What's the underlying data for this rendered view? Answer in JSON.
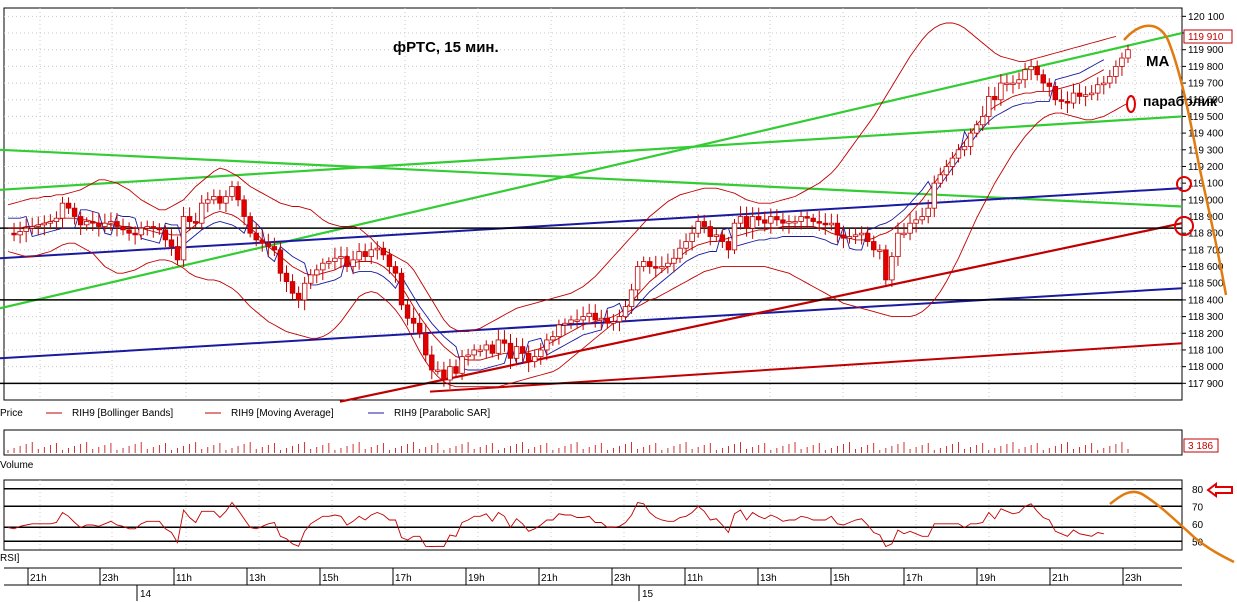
{
  "chart_data": {
    "type": "candlestick",
    "title": "фРТС,  15 мин.",
    "instrument": "RIH9",
    "price_axis": {
      "ylim": [
        117800,
        120150
      ],
      "ticks": [
        "120 100",
        "120 000",
        "119 900",
        "119 800",
        "119 700",
        "119 600",
        "119 500",
        "119 400",
        "119 300",
        "119 200",
        "119 100",
        "119 000",
        "118 900",
        "118 800",
        "118 700",
        "118 600",
        "118 500",
        "118 400",
        "118 300",
        "118 200",
        "118 100",
        "118 000",
        "117 900"
      ],
      "tick_values": [
        120100,
        120000,
        119900,
        119800,
        119700,
        119600,
        119500,
        119400,
        119300,
        119200,
        119100,
        119000,
        118900,
        118800,
        118700,
        118600,
        118500,
        118400,
        118300,
        118200,
        118100,
        118000,
        117900
      ],
      "last_price": "119 910"
    },
    "time_axis": {
      "hour_labels": [
        "21h",
        "23h",
        "11h",
        "13h",
        "15h",
        "17h",
        "19h",
        "21h",
        "23h",
        "11h",
        "13h",
        "15h",
        "17h",
        "19h",
        "21h",
        "23h"
      ],
      "day_labels": [
        "14",
        "15"
      ]
    },
    "legend": [
      {
        "label": "Price",
        "color": "#c00000"
      },
      {
        "label": "RIH9 [Bollinger Bands]",
        "color": "#c00000"
      },
      {
        "label": "RIH9 [Moving Average]",
        "color": "#c00000"
      },
      {
        "label": "RIH9 [Parabolic SAR]",
        "color": "#1a1aa0"
      }
    ],
    "annotations": {
      "ma": "MA",
      "parabolic": "параболик"
    },
    "price_series": [
      118800,
      118790,
      118810,
      118830,
      118840,
      118850,
      118860,
      118870,
      118890,
      118980,
      118950,
      118900,
      118850,
      118870,
      118860,
      118840,
      118860,
      118870,
      118840,
      118820,
      118800,
      118790,
      118830,
      118840,
      118830,
      118820,
      118760,
      118720,
      118640,
      118900,
      118870,
      118860,
      118980,
      119000,
      119020,
      118980,
      119020,
      119080,
      119000,
      118900,
      118800,
      118760,
      118740,
      118720,
      118700,
      118560,
      118510,
      118440,
      118400,
      118500,
      118550,
      118580,
      118620,
      118630,
      118650,
      118660,
      118600,
      118640,
      118690,
      118660,
      118700,
      118710,
      118670,
      118600,
      118560,
      118370,
      118290,
      118260,
      118200,
      118070,
      117980,
      117980,
      117920,
      118000,
      117960,
      118060,
      118070,
      118100,
      118100,
      118130,
      118080,
      118160,
      118140,
      118050,
      118120,
      118080,
      118030,
      118060,
      118100,
      118160,
      118180,
      118250,
      118260,
      118280,
      118280,
      118300,
      118320,
      118280,
      118290,
      118260,
      118270,
      118300,
      118360,
      118460,
      118600,
      118630,
      118600,
      118590,
      118600,
      118620,
      118650,
      118710,
      118750,
      118800,
      118870,
      118840,
      118780,
      118790,
      118750,
      118700,
      118860,
      118900,
      118830,
      118900,
      118880,
      118860,
      118900,
      118880,
      118860,
      118870,
      118870,
      118900,
      118890,
      118870,
      118860,
      118850,
      118860,
      118790,
      118770,
      118780,
      118790,
      118800,
      118750,
      118700,
      118700,
      118520,
      118660,
      118800,
      118800,
      118860,
      118880,
      118900,
      118950,
      119100,
      119150,
      119200,
      119250,
      119300,
      119320,
      119400,
      119450,
      119500,
      119620,
      119600,
      119700,
      119700,
      119700,
      119720,
      119780,
      119800,
      119750,
      119700,
      119680,
      119600,
      119590,
      119580,
      119640,
      119620,
      119630,
      119640,
      119690,
      119700,
      119740,
      119800,
      119850,
      119900
    ],
    "moving_average": [
      118830,
      118830,
      118830,
      118840,
      118840,
      118850,
      118860,
      118870,
      118880,
      118890,
      118890,
      118890,
      118880,
      118880,
      118870,
      118860,
      118860,
      118850,
      118850,
      118840,
      118840,
      118830,
      118830,
      118820,
      118810,
      118800,
      118800,
      118790,
      118790,
      118790,
      118820,
      118850,
      118880,
      118900,
      118920,
      118930,
      118920,
      118910,
      118890,
      118860,
      118830,
      118800,
      118760,
      118720,
      118690,
      118660,
      118630,
      118600,
      118580,
      118560,
      118550,
      118550,
      118560,
      118570,
      118580,
      118600,
      118610,
      118620,
      118630,
      118630,
      118630,
      118620,
      118600,
      118570,
      118530,
      118480,
      118420,
      118360,
      118300,
      118250,
      118200,
      118160,
      118120,
      118090,
      118060,
      118050,
      118040,
      118040,
      118040,
      118050,
      118060,
      118070,
      118080,
      118080,
      118080,
      118080,
      118090,
      118100,
      118110,
      118130,
      118150,
      118170,
      118190,
      118210,
      118230,
      118250,
      118260,
      118270,
      118280,
      118290,
      118300,
      118320,
      118350,
      118390,
      118430,
      118470,
      118510,
      118540,
      118570,
      118600,
      118630,
      118660,
      118690,
      118710,
      118730,
      118740,
      118750,
      118750,
      118760,
      118770,
      118780,
      118790,
      118800,
      118810,
      118820,
      118820,
      118830,
      118830,
      118840,
      118840,
      118840,
      118840,
      118840,
      118840,
      118830,
      118820,
      118800,
      118790,
      118780,
      118770,
      118760,
      118760,
      118760,
      118770,
      118790,
      118800,
      118820,
      118850,
      118880,
      118920,
      118960,
      119000,
      119050,
      119100,
      119150,
      119200,
      119250,
      119300,
      119350,
      119400,
      119450,
      119490,
      119530,
      119560,
      119580,
      119600,
      119620,
      119630,
      119640,
      119640,
      119650,
      119650,
      119650,
      119660,
      119670,
      119680,
      119690,
      119700,
      119720,
      119740,
      119760,
      119780
    ],
    "bollinger_upper": [
      118970,
      118980,
      118990,
      119000,
      119010,
      119010,
      119020,
      119020,
      119030,
      119030,
      119040,
      119050,
      119060,
      119080,
      119100,
      119120,
      119120,
      119110,
      119100,
      119080,
      119060,
      119030,
      119000,
      118980,
      118960,
      118940,
      118940,
      118960,
      118980,
      119000,
      119040,
      119080,
      119110,
      119140,
      119170,
      119190,
      119180,
      119160,
      119140,
      119110,
      119080,
      119060,
      119040,
      119020,
      119000,
      118980,
      118970,
      118960,
      118960,
      118950,
      118940,
      118910,
      118880,
      118860,
      118850,
      118840,
      118840,
      118840,
      118830,
      118800,
      118770,
      118730,
      118700,
      118680,
      118660,
      118640,
      118620,
      118580,
      118520,
      118460,
      118400,
      118340,
      118280,
      118240,
      118220,
      118210,
      118210,
      118220,
      118230,
      118250,
      118270,
      118290,
      118310,
      118330,
      118350,
      118360,
      118370,
      118380,
      118390,
      118400,
      118410,
      118420,
      118430,
      118440,
      118460,
      118480,
      118510,
      118540,
      118580,
      118620,
      118660,
      118700,
      118740,
      118780,
      118820,
      118860,
      118900,
      118930,
      118960,
      118990,
      119010,
      119030,
      119040,
      119050,
      119060,
      119070,
      119070,
      119070,
      119060,
      119050,
      119040,
      119020,
      119000,
      118990,
      118980,
      118980,
      118980,
      118990,
      119000,
      119010,
      119020,
      119040,
      119060,
      119080,
      119100,
      119130,
      119160,
      119200,
      119250,
      119300,
      119350,
      119400,
      119450,
      119500,
      119560,
      119620,
      119680,
      119740,
      119800,
      119860,
      119910,
      119960,
      120000,
      120030,
      120050,
      120060,
      120060,
      120050,
      120030,
      120000,
      119970,
      119940,
      119910,
      119880,
      119860,
      119850,
      119840,
      119830,
      119830,
      119840,
      119850,
      119860,
      119870,
      119880,
      119890,
      119900,
      119910,
      119920,
      119930,
      119940,
      119950,
      119960,
      119970,
      119980
    ],
    "bollinger_lower": [
      118690,
      118680,
      118670,
      118660,
      118660,
      118670,
      118680,
      118690,
      118710,
      118730,
      118740,
      118740,
      118720,
      118700,
      118680,
      118640,
      118600,
      118580,
      118560,
      118560,
      118570,
      118580,
      118600,
      118620,
      118630,
      118640,
      118640,
      118630,
      118610,
      118590,
      118560,
      118540,
      118530,
      118520,
      118520,
      118510,
      118490,
      118470,
      118440,
      118400,
      118360,
      118330,
      118300,
      118270,
      118250,
      118230,
      118210,
      118200,
      118190,
      118180,
      118170,
      118170,
      118180,
      118200,
      118230,
      118270,
      118320,
      118370,
      118420,
      118440,
      118450,
      118440,
      118410,
      118380,
      118340,
      118290,
      118230,
      118160,
      118090,
      118030,
      117980,
      117940,
      117910,
      117890,
      117880,
      117880,
      117880,
      117880,
      117880,
      117880,
      117880,
      117880,
      117890,
      117900,
      117910,
      117920,
      117930,
      117940,
      117950,
      117960,
      117970,
      117990,
      118020,
      118050,
      118080,
      118110,
      118140,
      118170,
      118200,
      118230,
      118260,
      118290,
      118320,
      118340,
      118360,
      118380,
      118400,
      118410,
      118430,
      118450,
      118470,
      118490,
      118510,
      118530,
      118550,
      118570,
      118580,
      118590,
      118600,
      118600,
      118600,
      118600,
      118600,
      118600,
      118600,
      118600,
      118590,
      118580,
      118570,
      118560,
      118540,
      118520,
      118500,
      118480,
      118460,
      118440,
      118420,
      118400,
      118380,
      118370,
      118360,
      118350,
      118340,
      118330,
      118320,
      118310,
      118300,
      118300,
      118300,
      118300,
      118310,
      118330,
      118360,
      118400,
      118450,
      118510,
      118580,
      118650,
      118730,
      118810,
      118890,
      118960,
      119030,
      119100,
      119160,
      119220,
      119280,
      119330,
      119380,
      119420,
      119460,
      119490,
      119510,
      119520,
      119520,
      119510,
      119500,
      119490,
      119480,
      119480,
      119490,
      119500,
      119520,
      119540,
      119560,
      119580
    ],
    "volume": {
      "last_value": "3 186"
    },
    "rsi": {
      "label": "RSI",
      "ticks": [
        "80",
        "70",
        "60",
        "50"
      ],
      "tick_values": [
        80,
        70,
        60,
        50
      ],
      "ylim": [
        45,
        85
      ],
      "levels": [
        80,
        70,
        58,
        50
      ]
    },
    "panel_labels": {
      "price": "Price",
      "volume": "Volume",
      "rsi": "RSI]"
    }
  }
}
